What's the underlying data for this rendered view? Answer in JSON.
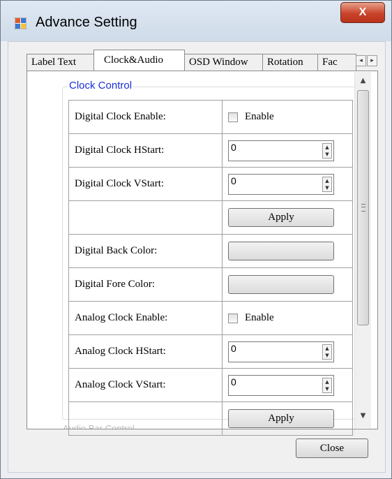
{
  "window": {
    "title": "Advance Setting",
    "close_glyph": "X",
    "app_icon": "app-window-icon"
  },
  "tabs": [
    {
      "label": "Label Text",
      "active": false
    },
    {
      "label": "Clock&Audio",
      "active": true
    },
    {
      "label": "OSD Window",
      "active": false
    },
    {
      "label": "Rotation",
      "active": false
    },
    {
      "label": "Fac",
      "active": false
    }
  ],
  "tab_scroll": {
    "left_glyph": "◂",
    "right_glyph": "▸"
  },
  "group": {
    "title": "Clock Control",
    "rows": [
      {
        "label": "Digital Clock Enable:",
        "control": "checkbox",
        "text": "Enable",
        "checked": false
      },
      {
        "label": "Digital Clock HStart:",
        "control": "numeric",
        "value": "0"
      },
      {
        "label": "Digital Clock VStart:",
        "control": "numeric",
        "value": "0"
      },
      {
        "label": "",
        "control": "button",
        "text": "Apply"
      },
      {
        "label": "Digital Back Color:",
        "control": "colorbutton",
        "text": ""
      },
      {
        "label": "Digital Fore Color:",
        "control": "colorbutton",
        "text": ""
      },
      {
        "label": "Analog Clock Enable:",
        "control": "checkbox",
        "text": "Enable",
        "checked": false
      },
      {
        "label": "Analog Clock HStart:",
        "control": "numeric",
        "value": "0"
      },
      {
        "label": "Analog Clock VStart:",
        "control": "numeric",
        "value": "0"
      },
      {
        "label": "",
        "control": "button",
        "text": "Apply"
      }
    ]
  },
  "next_group_title": "Audio Bar Control",
  "scrollbar": {
    "up_glyph": "▲",
    "down_glyph": "▼"
  },
  "footer": {
    "close_label": "Close"
  },
  "colors": {
    "group_title": "#1a2fd6",
    "close_button": "#c9442a"
  }
}
